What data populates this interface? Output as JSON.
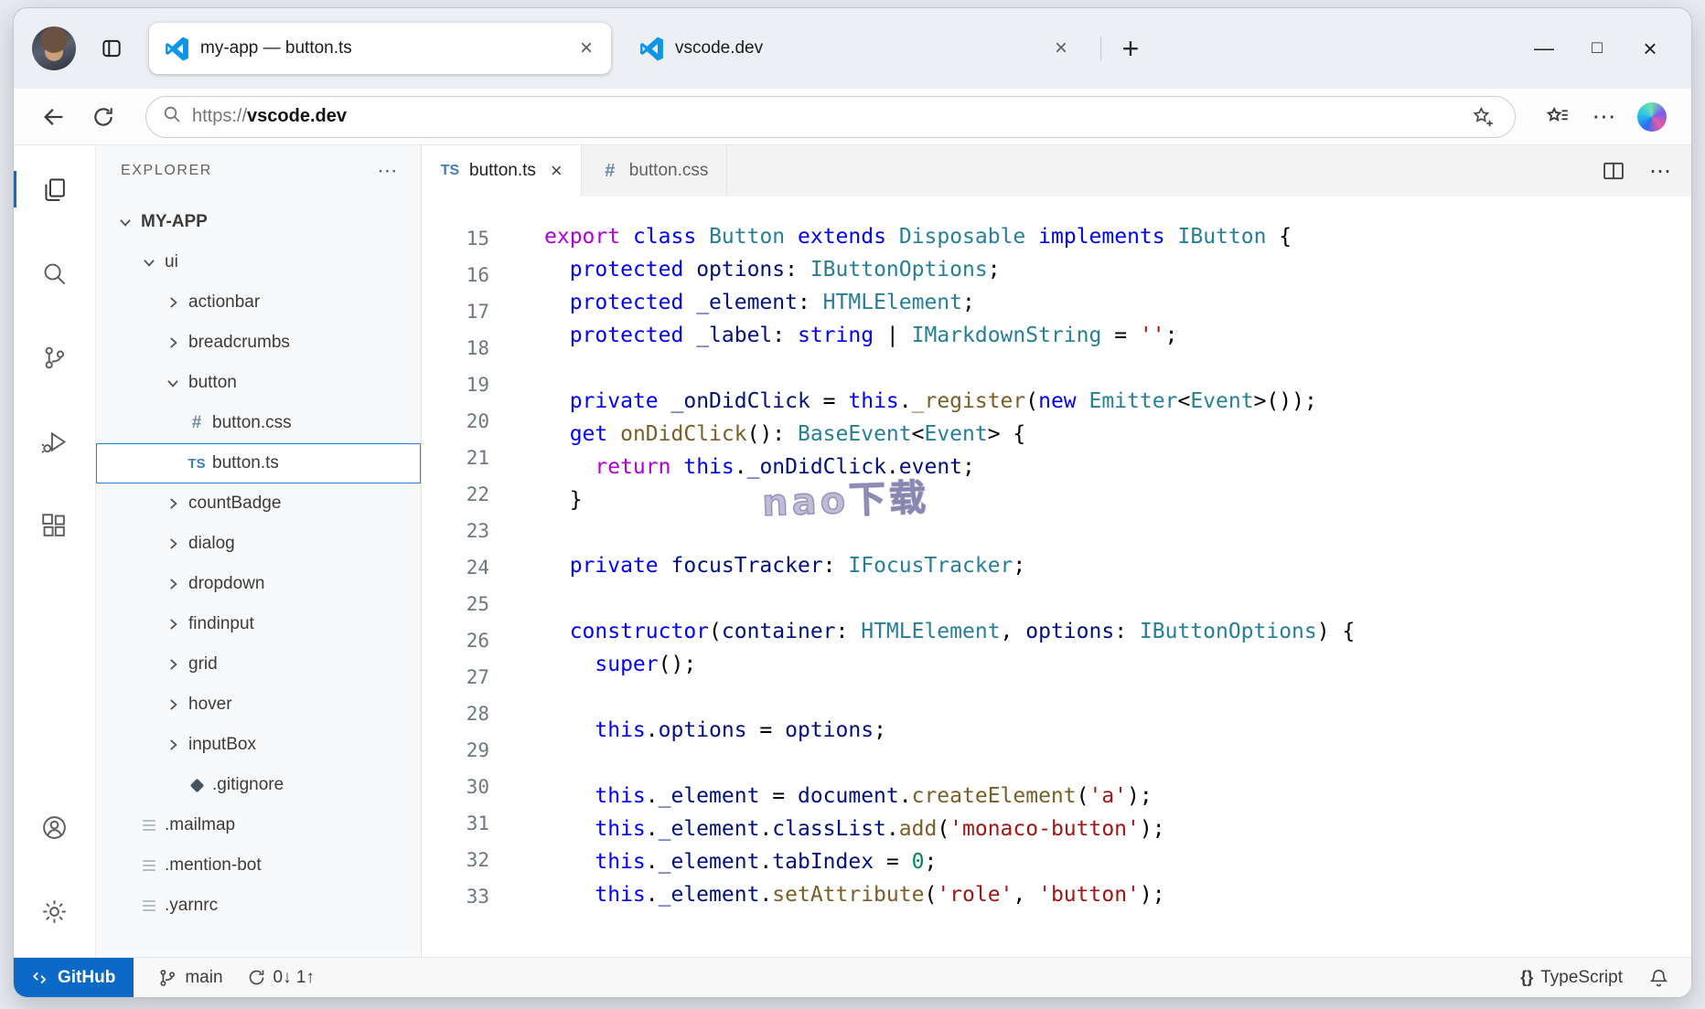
{
  "colors": {
    "kw": "#0000ff",
    "ctrl": "#af00db",
    "type": "#267f99",
    "var": "#001080",
    "fn": "#795e26",
    "str": "#a31515",
    "num": "#098658",
    "linenum": "#6e7781",
    "remote": "#0b69c7",
    "ts": "#3e7fbe",
    "css": "#6d8aa0",
    "accent": "#0a6fc2"
  },
  "icons": {
    "ts": "TS",
    "css": "#"
  },
  "browser": {
    "tabs": [
      {
        "title": "my-app — button.ts",
        "active": true,
        "close_label": "×"
      },
      {
        "title": "vscode.dev",
        "active": false,
        "close_label": "×"
      }
    ],
    "new_tab_label": "+",
    "window_controls": {
      "minimize": "—",
      "maximize": "□",
      "close": "×"
    },
    "address": {
      "scheme": "https://",
      "host": "vscode.dev"
    },
    "more_label": "⋯"
  },
  "vscode": {
    "explorer": {
      "header": "EXPLORER",
      "more_label": "⋯",
      "tree": [
        {
          "label": "MY-APP",
          "kind": "folder",
          "expanded": true,
          "indent": 0,
          "root": true
        },
        {
          "label": "ui",
          "kind": "folder",
          "expanded": true,
          "indent": 1
        },
        {
          "label": "actionbar",
          "kind": "folder",
          "expanded": false,
          "indent": 2
        },
        {
          "label": "breadcrumbs",
          "kind": "folder",
          "expanded": false,
          "indent": 2
        },
        {
          "label": "button",
          "kind": "folder",
          "expanded": true,
          "indent": 2
        },
        {
          "label": "button.css",
          "kind": "file",
          "icon": "css",
          "indent": 3
        },
        {
          "label": "button.ts",
          "kind": "file",
          "icon": "ts",
          "indent": 3,
          "selected": true
        },
        {
          "label": "countBadge",
          "kind": "folder",
          "expanded": false,
          "indent": 2
        },
        {
          "label": "dialog",
          "kind": "folder",
          "expanded": false,
          "indent": 2
        },
        {
          "label": "dropdown",
          "kind": "folder",
          "expanded": false,
          "indent": 2
        },
        {
          "label": "findinput",
          "kind": "folder",
          "expanded": false,
          "indent": 2
        },
        {
          "label": "grid",
          "kind": "folder",
          "expanded": false,
          "indent": 2
        },
        {
          "label": "hover",
          "kind": "folder",
          "expanded": false,
          "indent": 2
        },
        {
          "label": "inputBox",
          "kind": "folder",
          "expanded": false,
          "indent": 2
        },
        {
          "label": ".gitignore",
          "kind": "file",
          "icon": "git",
          "indent": 3
        },
        {
          "label": ".mailmap",
          "kind": "file",
          "icon": "file",
          "indent": 1
        },
        {
          "label": ".mention-bot",
          "kind": "file",
          "icon": "file",
          "indent": 1
        },
        {
          "label": ".yarnrc",
          "kind": "file",
          "icon": "file",
          "indent": 1
        }
      ]
    },
    "editor": {
      "tabs": [
        {
          "label": "button.ts",
          "icon_label": "TS",
          "close_label": "×",
          "active": true
        },
        {
          "label": "button.css",
          "icon_label": "#",
          "active": false
        }
      ],
      "more_label": "⋯",
      "line_numbers": [
        "15",
        "16",
        "17",
        "18",
        "19",
        "20",
        "21",
        "22",
        "23",
        "24",
        "25",
        "26",
        "27",
        "28",
        "29",
        "30",
        "31",
        "32",
        "33"
      ],
      "code_lines": [
        [
          [
            "export",
            "ctrl"
          ],
          [
            " "
          ],
          [
            "class",
            "kw"
          ],
          [
            " "
          ],
          [
            "Button",
            "type"
          ],
          [
            " "
          ],
          [
            "extends",
            "kw"
          ],
          [
            " "
          ],
          [
            "Disposable",
            "type"
          ],
          [
            " "
          ],
          [
            "implements",
            "kw"
          ],
          [
            " "
          ],
          [
            "IButton",
            "type"
          ],
          [
            " {"
          ]
        ],
        [
          [
            "  "
          ],
          [
            "protected",
            "kw"
          ],
          [
            " "
          ],
          [
            "options",
            "var"
          ],
          [
            ": "
          ],
          [
            "IButtonOptions",
            "type"
          ],
          [
            ";"
          ]
        ],
        [
          [
            "  "
          ],
          [
            "protected",
            "kw"
          ],
          [
            " "
          ],
          [
            "_element",
            "var"
          ],
          [
            ": "
          ],
          [
            "HTMLElement",
            "type"
          ],
          [
            ";"
          ]
        ],
        [
          [
            "  "
          ],
          [
            "protected",
            "kw"
          ],
          [
            " "
          ],
          [
            "_label",
            "var"
          ],
          [
            ": "
          ],
          [
            "string",
            "kw"
          ],
          [
            " | "
          ],
          [
            "IMarkdownString",
            "type"
          ],
          [
            " = "
          ],
          [
            "''",
            "str"
          ],
          [
            ";"
          ]
        ],
        [],
        [
          [
            "  "
          ],
          [
            "private",
            "kw"
          ],
          [
            " "
          ],
          [
            "_onDidClick",
            "var"
          ],
          [
            " = "
          ],
          [
            "this",
            "kw"
          ],
          [
            "."
          ],
          [
            "_register",
            "fn"
          ],
          [
            "("
          ],
          [
            "new",
            "kw"
          ],
          [
            " "
          ],
          [
            "Emitter",
            "type"
          ],
          [
            "<"
          ],
          [
            "Event",
            "type"
          ],
          [
            ">());"
          ]
        ],
        [
          [
            "  "
          ],
          [
            "get",
            "kw"
          ],
          [
            " "
          ],
          [
            "onDidClick",
            "fn"
          ],
          [
            "(): "
          ],
          [
            "BaseEvent",
            "type"
          ],
          [
            "<"
          ],
          [
            "Event",
            "type"
          ],
          [
            "> {"
          ]
        ],
        [
          [
            "    "
          ],
          [
            "return",
            "ctrl"
          ],
          [
            " "
          ],
          [
            "this",
            "kw"
          ],
          [
            "."
          ],
          [
            "_onDidClick",
            "var"
          ],
          [
            "."
          ],
          [
            "event",
            "var"
          ],
          [
            ";"
          ]
        ],
        [
          [
            "  }"
          ]
        ],
        [],
        [
          [
            "  "
          ],
          [
            "private",
            "kw"
          ],
          [
            " "
          ],
          [
            "focusTracker",
            "var"
          ],
          [
            ": "
          ],
          [
            "IFocusTracker",
            "type"
          ],
          [
            ";"
          ]
        ],
        [],
        [
          [
            "  "
          ],
          [
            "constructor",
            "kw"
          ],
          [
            "("
          ],
          [
            "container",
            "var"
          ],
          [
            ": "
          ],
          [
            "HTMLElement",
            "type"
          ],
          [
            ", "
          ],
          [
            "options",
            "var"
          ],
          [
            ": "
          ],
          [
            "IButtonOptions",
            "type"
          ],
          [
            ") {"
          ]
        ],
        [
          [
            "    "
          ],
          [
            "super",
            "kw"
          ],
          [
            "();"
          ]
        ],
        [],
        [
          [
            "    "
          ],
          [
            "this",
            "kw"
          ],
          [
            "."
          ],
          [
            "options",
            "var"
          ],
          [
            " = "
          ],
          [
            "options",
            "var"
          ],
          [
            ";"
          ]
        ],
        [],
        [
          [
            "    "
          ],
          [
            "this",
            "kw"
          ],
          [
            "."
          ],
          [
            "_element",
            "var"
          ],
          [
            " = "
          ],
          [
            "document",
            "var"
          ],
          [
            "."
          ],
          [
            "createElement",
            "fn"
          ],
          [
            "("
          ],
          [
            "'a'",
            "str"
          ],
          [
            ");"
          ]
        ],
        [
          [
            "    "
          ],
          [
            "this",
            "kw"
          ],
          [
            "."
          ],
          [
            "_element",
            "var"
          ],
          [
            "."
          ],
          [
            "classList",
            "var"
          ],
          [
            "."
          ],
          [
            "add",
            "fn"
          ],
          [
            "("
          ],
          [
            "'monaco-button'",
            "str"
          ],
          [
            ");"
          ]
        ],
        [
          [
            "    "
          ],
          [
            "this",
            "kw"
          ],
          [
            "."
          ],
          [
            "_element",
            "var"
          ],
          [
            "."
          ],
          [
            "tabIndex",
            "var"
          ],
          [
            " = "
          ],
          [
            "0",
            "num"
          ],
          [
            ";"
          ]
        ],
        [
          [
            "    "
          ],
          [
            "this",
            "kw"
          ],
          [
            "."
          ],
          [
            "_element",
            "var"
          ],
          [
            "."
          ],
          [
            "setAttribute",
            "fn"
          ],
          [
            "("
          ],
          [
            "'role'",
            "str"
          ],
          [
            ", "
          ],
          [
            "'button'",
            "str"
          ],
          [
            ");"
          ]
        ]
      ]
    },
    "status_bar": {
      "remote_label": "GitHub",
      "branch": "main",
      "sync": "0↓ 1↑",
      "language_icon": "{}",
      "language": "TypeScript"
    }
  },
  "watermark": "nao下载"
}
